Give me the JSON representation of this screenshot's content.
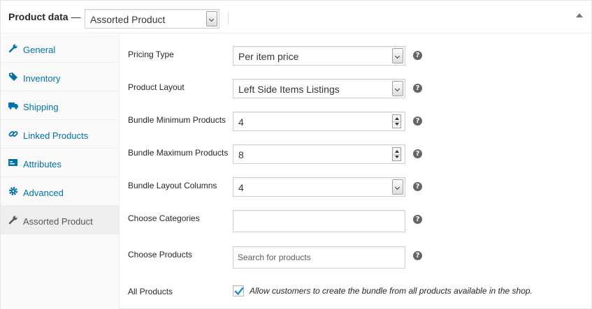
{
  "header": {
    "title": "Product data",
    "dash": "—",
    "product_type": "Assorted Product"
  },
  "sidebar": {
    "tabs": [
      {
        "label": "General",
        "icon": "wrench-icon"
      },
      {
        "label": "Inventory",
        "icon": "tag-icon"
      },
      {
        "label": "Shipping",
        "icon": "truck-icon"
      },
      {
        "label": "Linked Products",
        "icon": "link-icon"
      },
      {
        "label": "Attributes",
        "icon": "list-icon"
      },
      {
        "label": "Advanced",
        "icon": "gear-icon"
      },
      {
        "label": "Assorted Product",
        "icon": "wrench-icon",
        "active": true
      }
    ]
  },
  "form": {
    "pricing_type": {
      "label": "Pricing Type",
      "value": "Per item price"
    },
    "product_layout": {
      "label": "Product Layout",
      "value": "Left Side Items Listings"
    },
    "bundle_min": {
      "label": "Bundle Minimum Products",
      "value": "4"
    },
    "bundle_max": {
      "label": "Bundle Maximum Products",
      "value": "8"
    },
    "bundle_columns": {
      "label": "Bundle Layout Columns",
      "value": "4"
    },
    "choose_categories": {
      "label": "Choose Categories",
      "value": ""
    },
    "choose_products": {
      "label": "Choose Products",
      "placeholder": "Search for products"
    },
    "all_products": {
      "label": "All Products",
      "checked": true,
      "description": "Allow customers to create the bundle from all products available in the shop."
    },
    "help_glyph": "?"
  },
  "colors": {
    "link": "#0073aa",
    "active_tab_bg": "#eeeeee",
    "checkmark": "#1e8cbe",
    "help_icon": "#666666"
  }
}
